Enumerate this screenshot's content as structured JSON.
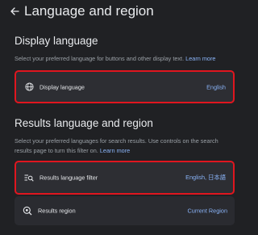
{
  "header": {
    "title": "Language and region"
  },
  "display_section": {
    "title": "Display language",
    "description": "Select your preferred language for buttons and other display text.",
    "learn_more": "Learn more",
    "row": {
      "label": "Display language",
      "value": "English",
      "icon": "globe-icon"
    }
  },
  "results_section": {
    "title": "Results language and region",
    "description": "Select your preferred languages for search results. Use controls on the search results page to turn this filter on.",
    "learn_more": "Learn more",
    "rows": [
      {
        "label": "Results language filter",
        "value": "English, 日本語",
        "icon": "language-search-icon"
      },
      {
        "label": "Results region",
        "value": "Current Region",
        "icon": "location-search-icon"
      }
    ]
  },
  "colors": {
    "background": "#202124",
    "row_background": "#2d2e33",
    "accent": "#8ab4f8",
    "highlight_border": "#e0161f"
  }
}
